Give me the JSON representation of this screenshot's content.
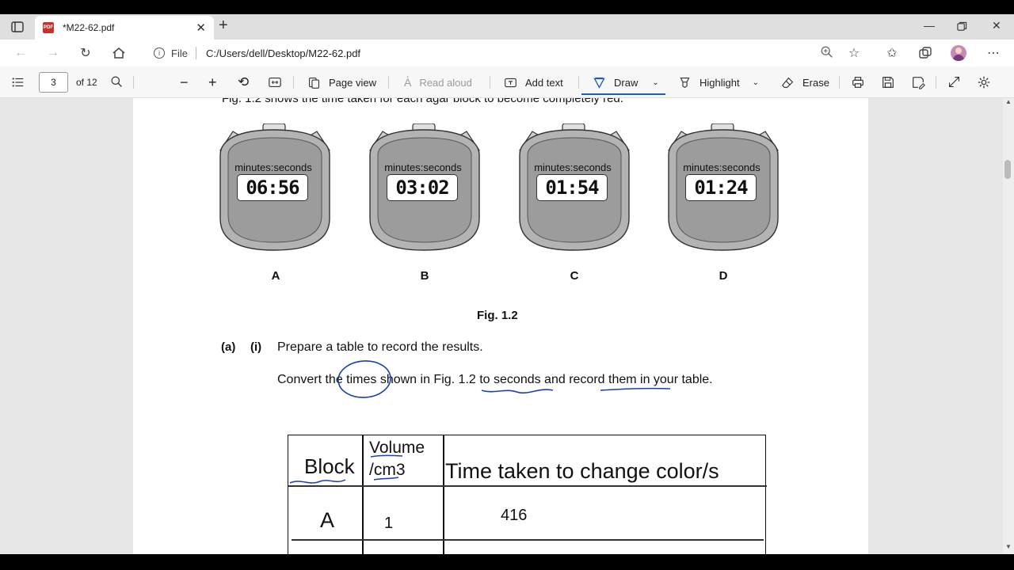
{
  "browser": {
    "tab_title": "*M22-62.pdf",
    "url_scheme_label": "File",
    "url_path": "C:/Users/dell/Desktop/M22-62.pdf"
  },
  "pdf_toolbar": {
    "current_page": "3",
    "page_total": "of 12",
    "page_view": "Page view",
    "read_aloud": "Read aloud",
    "add_text": "Add text",
    "draw": "Draw",
    "highlight": "Highlight",
    "erase": "Erase"
  },
  "document": {
    "partial_heading": "Fig. 1.2 shows the time taken for each agar block to become completely red.",
    "watch_caption": "minutes:seconds",
    "watches": [
      {
        "letter": "A",
        "time": "06:56"
      },
      {
        "letter": "B",
        "time": "03:02"
      },
      {
        "letter": "C",
        "time": "01:54"
      },
      {
        "letter": "D",
        "time": "01:24"
      }
    ],
    "figure_label": "Fig. 1.2",
    "part_label": "(a)",
    "subpart_label": "(i)",
    "instruction_1": "Prepare a table to record the results.",
    "instruction_2": "Convert the times shown in Fig. 1.2 to seconds and record them in your table."
  },
  "table": {
    "header_block": "Block",
    "header_volume_1": "Volume",
    "header_volume_2": "/cm3",
    "header_time": "Time taken to change color/s",
    "row_a_block": "A",
    "row_a_volume": "1",
    "row_a_time": "416"
  },
  "colors": {
    "ink": "#1a3fb8",
    "accent": "#1a5fb4"
  }
}
